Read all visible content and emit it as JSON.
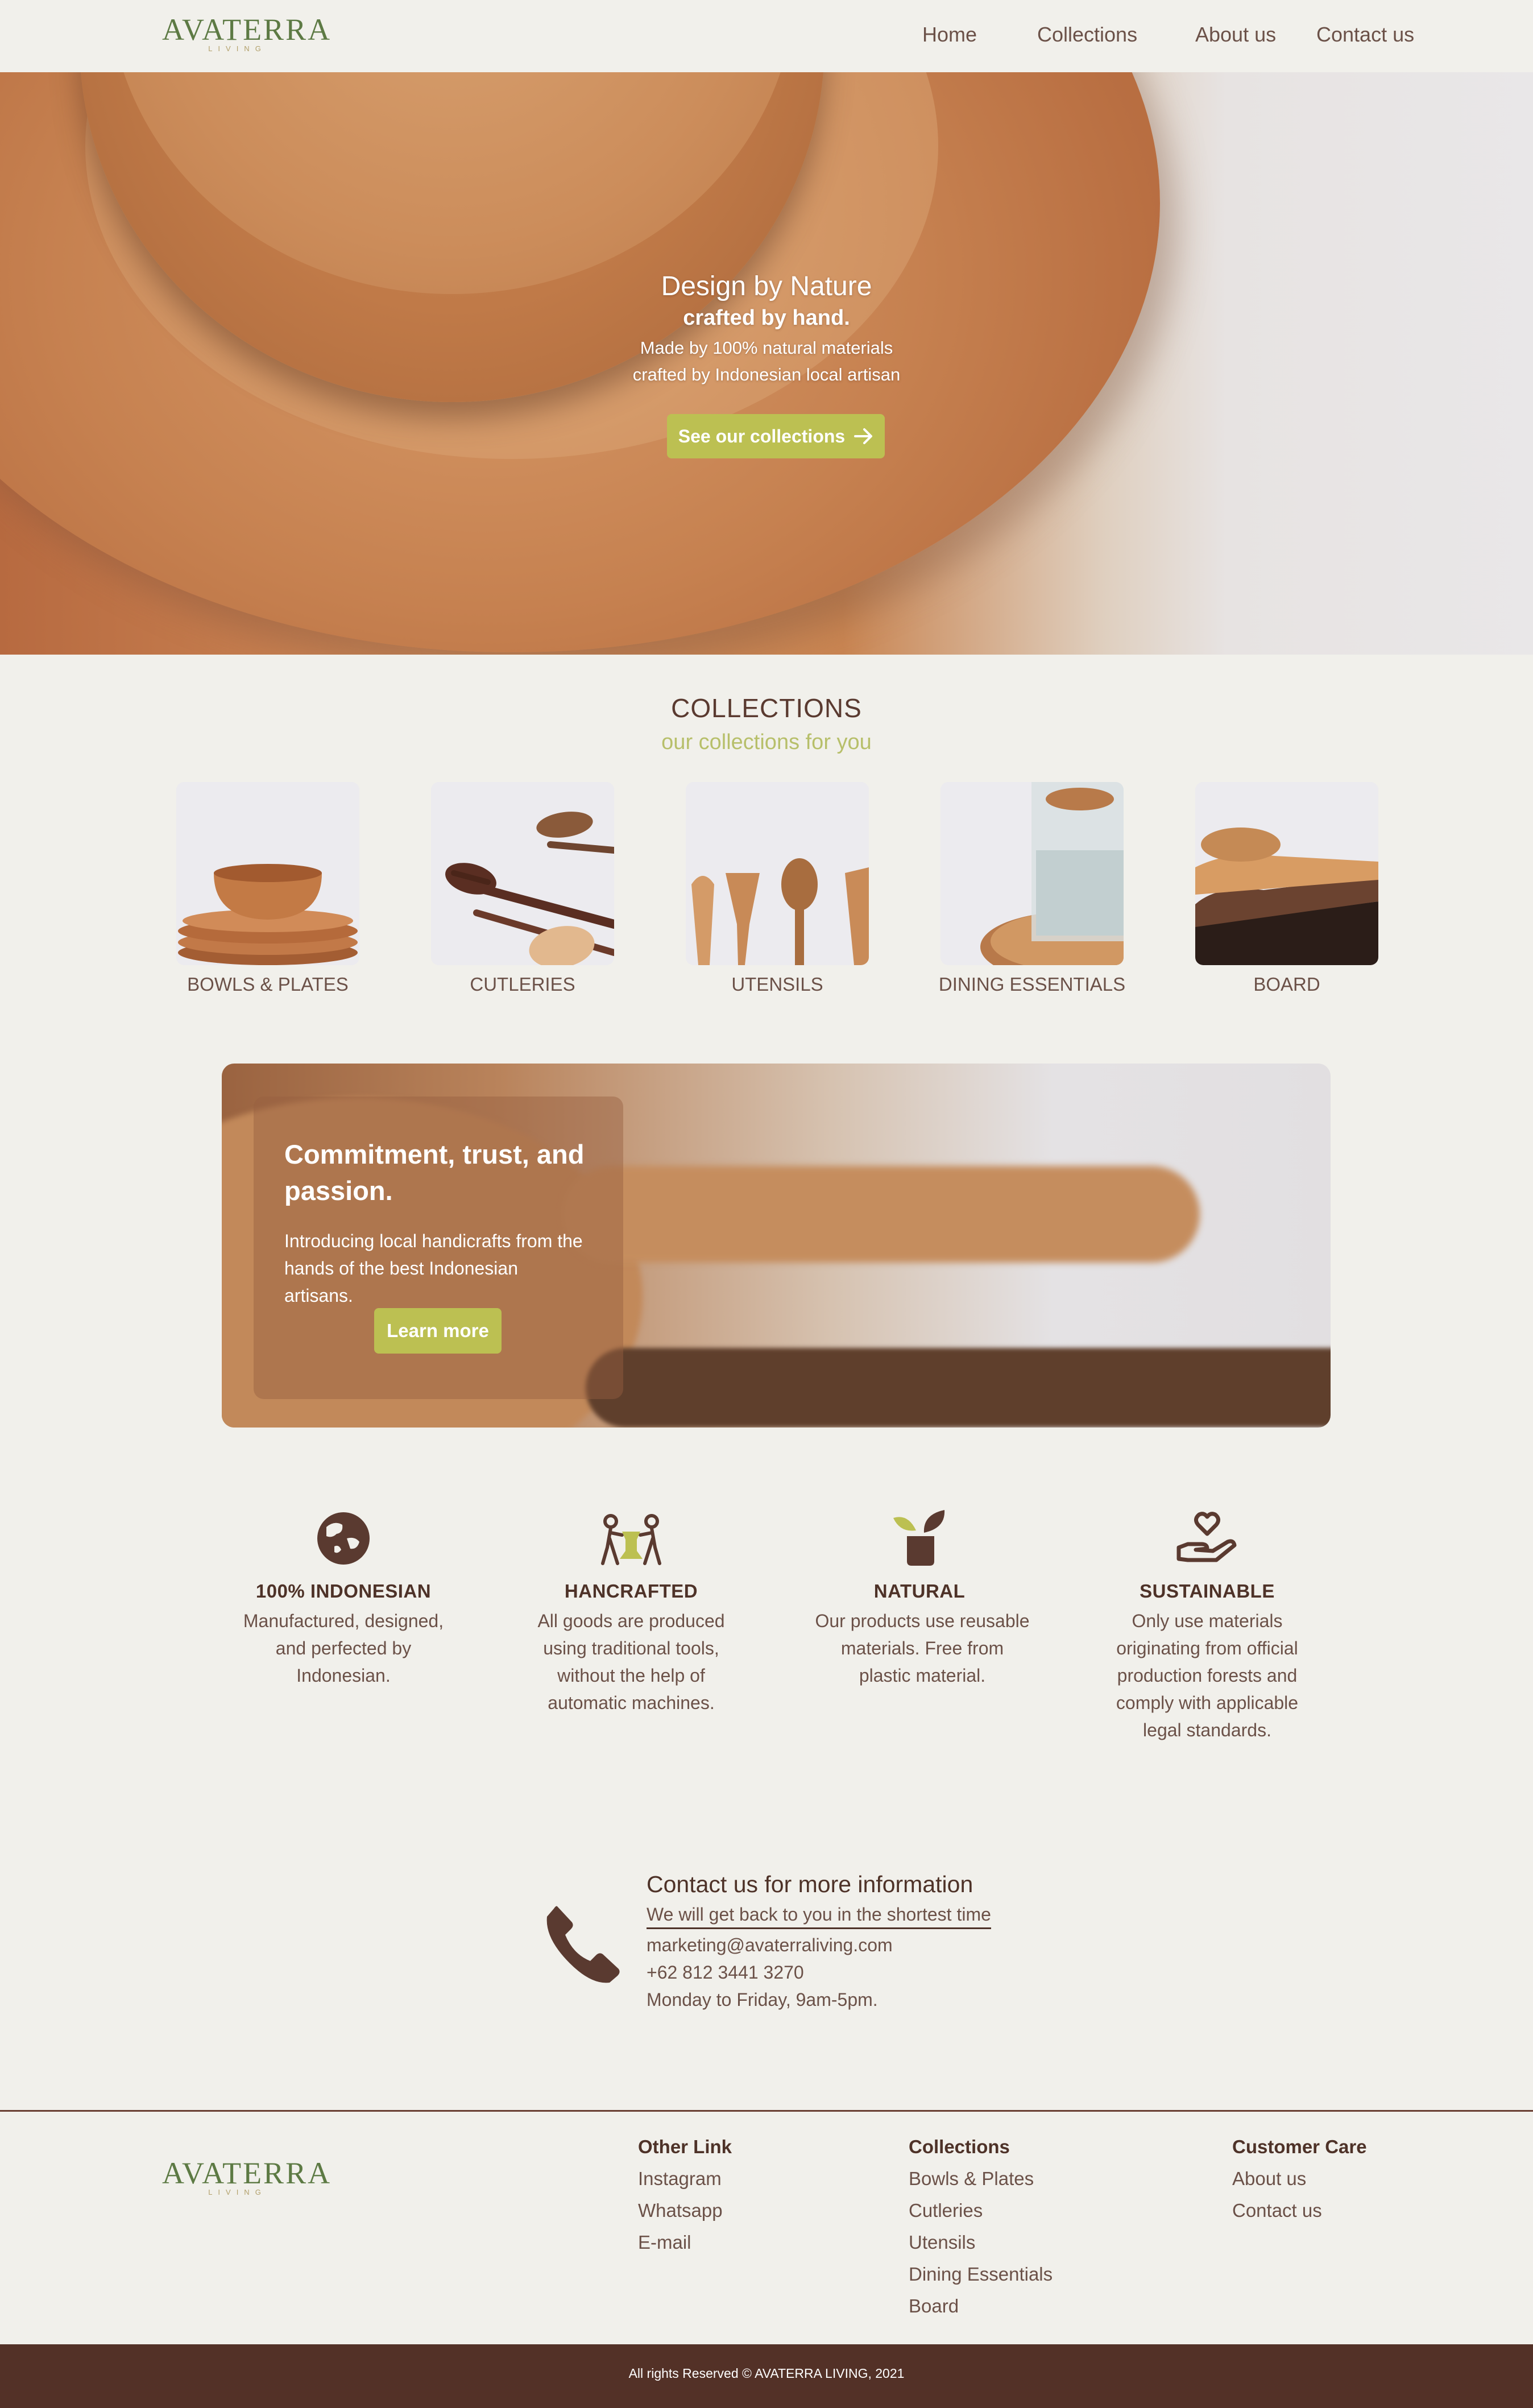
{
  "brand": {
    "name": "AVATERRA",
    "tagline": "LIVING",
    "brand_color": "#5d7a44"
  },
  "nav": {
    "items": [
      {
        "label": "Home"
      },
      {
        "label": "Collections"
      },
      {
        "label": "About us"
      },
      {
        "label": "Contact us"
      }
    ]
  },
  "hero": {
    "title": "Design by Nature",
    "subtitle": "crafted by hand.",
    "line1": "Made by 100% natural materials",
    "line2": "crafted by Indonesian local artisan",
    "cta_label": "See our collections",
    "cta_icon": "arrow-right-icon"
  },
  "collections": {
    "title": "COLLECTIONS",
    "subtitle": "our collections for you",
    "items": [
      {
        "label": "BOWLS & PLATES"
      },
      {
        "label": "CUTLERIES"
      },
      {
        "label": "UTENSILS"
      },
      {
        "label": "DINING ESSENTIALS"
      },
      {
        "label": "BOARD"
      }
    ]
  },
  "banner": {
    "title": "Commitment, trust, and passion.",
    "text": "Introducing local handicrafts from the hands of the best Indonesian artisans.",
    "button_label": "Learn more"
  },
  "features": [
    {
      "icon": "globe-asia-icon",
      "title": "100% INDONESIAN",
      "text": "Manufactured, designed, and perfected by Indonesian."
    },
    {
      "icon": "artisans-craft-icon",
      "title": "HANCRAFTED",
      "text": "All goods are produced using traditional tools, without the help of automatic machines."
    },
    {
      "icon": "plant-pot-icon",
      "title": "NATURAL",
      "text": "Our products use reusable materials. Free from plastic material."
    },
    {
      "icon": "hand-heart-icon",
      "title": "SUSTAINABLE",
      "text": "Only use materials originating from official production forests and comply with applicable legal standards."
    }
  ],
  "contact": {
    "title": "Contact us for more information",
    "subtitle": "We will get back to you in the shortest time",
    "email": "marketing@avaterraliving.com",
    "phone": "+62 812 3441 3270",
    "hours": "Monday to Friday, 9am-5pm.",
    "icon": "phone-icon"
  },
  "footer": {
    "columns": [
      {
        "heading": "Other Link",
        "links": [
          "Instagram",
          "Whatsapp",
          "E-mail"
        ]
      },
      {
        "heading": "Collections",
        "links": [
          "Bowls & Plates",
          "Cutleries",
          "Utensils",
          "Dining Essentials",
          "Board"
        ]
      },
      {
        "heading": "Customer Care",
        "links": [
          "About us",
          "Contact us"
        ]
      }
    ],
    "copyright": "All rights Reserved © AVATERRA LIVING, 2021"
  },
  "colors": {
    "background": "#f1f0eb",
    "accent": "#bcc052",
    "text_dark": "#4e3228",
    "footer_bar": "#533127"
  }
}
